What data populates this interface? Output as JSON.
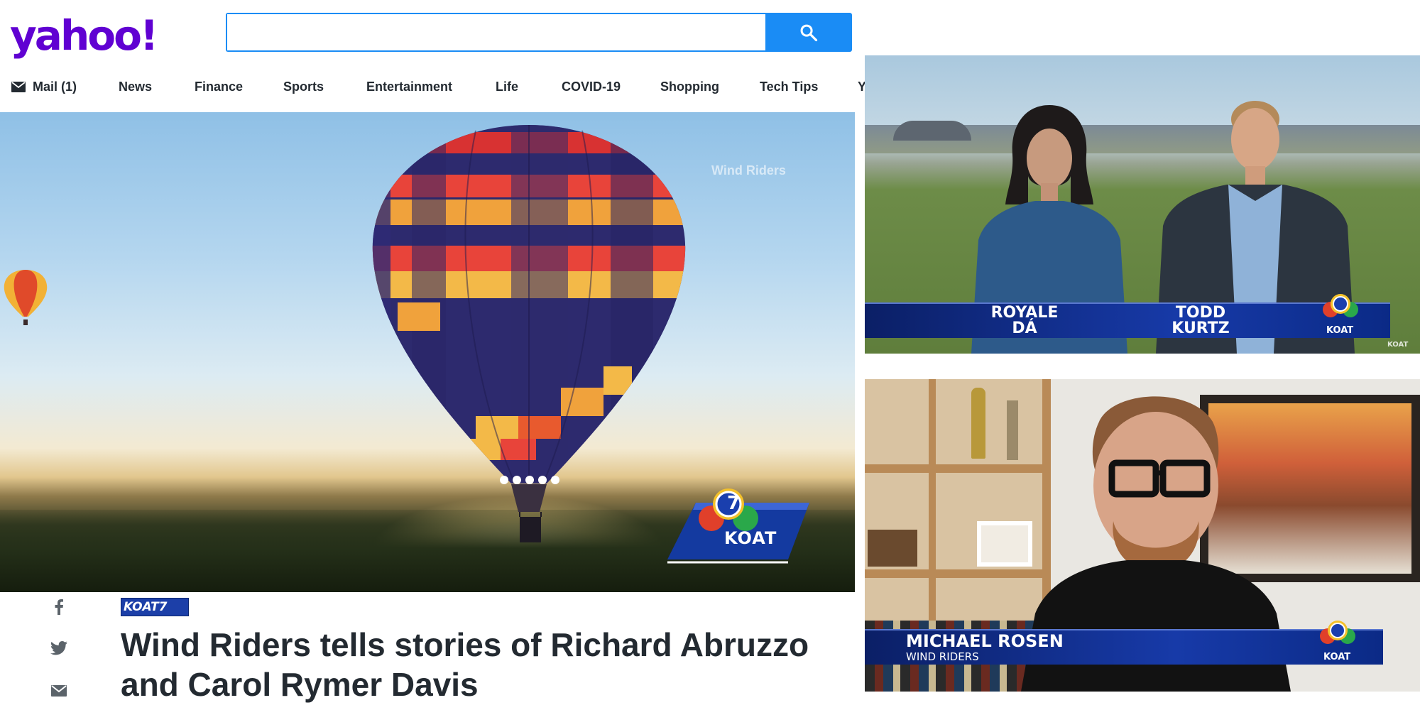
{
  "brand": {
    "logo_text": "yahoo!",
    "accent_color": "#6001d2",
    "search_color": "#1a8cf5"
  },
  "search": {
    "placeholder": "",
    "value": "",
    "button_icon": "search-icon"
  },
  "nav": {
    "mail_label": "Mail (1)",
    "items": [
      "News",
      "Finance",
      "Sports",
      "Entertainment",
      "Life",
      "COVID-19",
      "Shopping",
      "Tech Tips",
      "Y"
    ]
  },
  "hero": {
    "watermark": "Wind Riders",
    "station_logo": "KOAT",
    "station_number": "7"
  },
  "share": {
    "icons": [
      "facebook-icon",
      "twitter-icon",
      "mail-icon"
    ]
  },
  "article": {
    "source_logo": "KOAT7",
    "headline": "Wind Riders tells stories of Richard Abruzzo and Carol Rymer Davis"
  },
  "video_top": {
    "name_left_line1": "ROYALE",
    "name_left_line2": "DÁ",
    "name_right_line1": "TODD",
    "name_right_line2": "KURTZ",
    "station": "KOAT",
    "corner_mark": "KOAT"
  },
  "video_bottom": {
    "name": "MICHAEL ROSEN",
    "subtitle": "WIND RIDERS",
    "station": "KOAT"
  }
}
